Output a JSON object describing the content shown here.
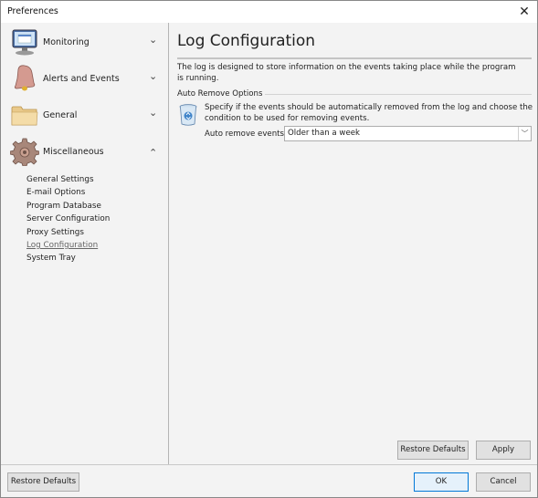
{
  "window": {
    "title": "Preferences",
    "close_icon": "close-icon"
  },
  "sidebar": {
    "groups": [
      {
        "label": "Monitoring",
        "icon": "monitor-icon",
        "expanded": false
      },
      {
        "label": "Alerts and Events",
        "icon": "bell-icon",
        "expanded": false
      },
      {
        "label": "General",
        "icon": "folder-icon",
        "expanded": false
      },
      {
        "label": "Miscellaneous",
        "icon": "gear-icon",
        "expanded": true
      }
    ],
    "chevron_down": "⌄",
    "chevron_up": "⌃",
    "subitems": [
      {
        "label": "General Settings",
        "active": false
      },
      {
        "label": "E-mail Options",
        "active": false
      },
      {
        "label": "Program Database",
        "active": false
      },
      {
        "label": "Server Configuration",
        "active": false
      },
      {
        "label": "Proxy Settings",
        "active": false
      },
      {
        "label": "Log Configuration",
        "active": true
      },
      {
        "label": "System Tray",
        "active": false
      }
    ]
  },
  "main": {
    "title": "Log Configuration",
    "description": "The log is designed to store information on the events taking place while the program is running.",
    "section": {
      "label": "Auto Remove Options",
      "icon": "recycle-bin-icon",
      "description": "Specify if the events should be automatically removed from the log and choose the condition to be used for removing events.",
      "field_label": "Auto remove events:",
      "selected_value": "Older than a week"
    },
    "restore_defaults_label": "Restore Defaults",
    "apply_label": "Apply"
  },
  "footer": {
    "restore_defaults_label": "Restore Defaults",
    "ok_label": "OK",
    "cancel_label": "Cancel"
  }
}
